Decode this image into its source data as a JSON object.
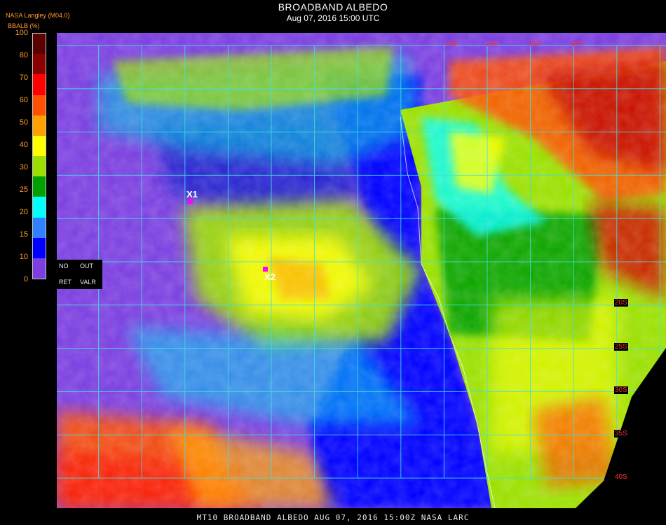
{
  "header": {
    "title": "BROADBAND ALBEDO",
    "datetime": "Aug 07, 2016 15:00 UTC",
    "source": "NASA Langley (M04.0)",
    "variable_label": "BBALB (%)"
  },
  "colorbar": {
    "ticks": [
      "100",
      "80",
      "70",
      "60",
      "50",
      "40",
      "30",
      "25",
      "20",
      "15",
      "10",
      "0"
    ],
    "colors": [
      "#5a0000",
      "#8b0000",
      "#ff0000",
      "#ff5000",
      "#ffa000",
      "#ffff00",
      "#9be000",
      "#00a000",
      "#00ffff",
      "#3080ff",
      "#0000ff",
      "#7b3fe0"
    ]
  },
  "legend_box": {
    "no_ret": [
      "NO",
      "RET"
    ],
    "out_valr": [
      "OUT",
      "VALR"
    ]
  },
  "lat_labels": [
    "20S",
    "25S",
    "30S",
    "35S",
    "40S"
  ],
  "lon_labels": [
    "15E",
    "20E",
    "25E",
    "30E"
  ],
  "markers": [
    {
      "label": "X1"
    },
    {
      "label": "X2"
    }
  ],
  "footer": {
    "text": "MT10  BROADBAND ALBEDO   AUG 07, 2016 15:00Z   NASA LARC"
  },
  "colors": {
    "grid": "#40e0e0",
    "lat_label": "#ff3030",
    "tick_label": "#ff9a2e"
  },
  "icons": [
    "satellite-albedo-map",
    "colorbar"
  ]
}
